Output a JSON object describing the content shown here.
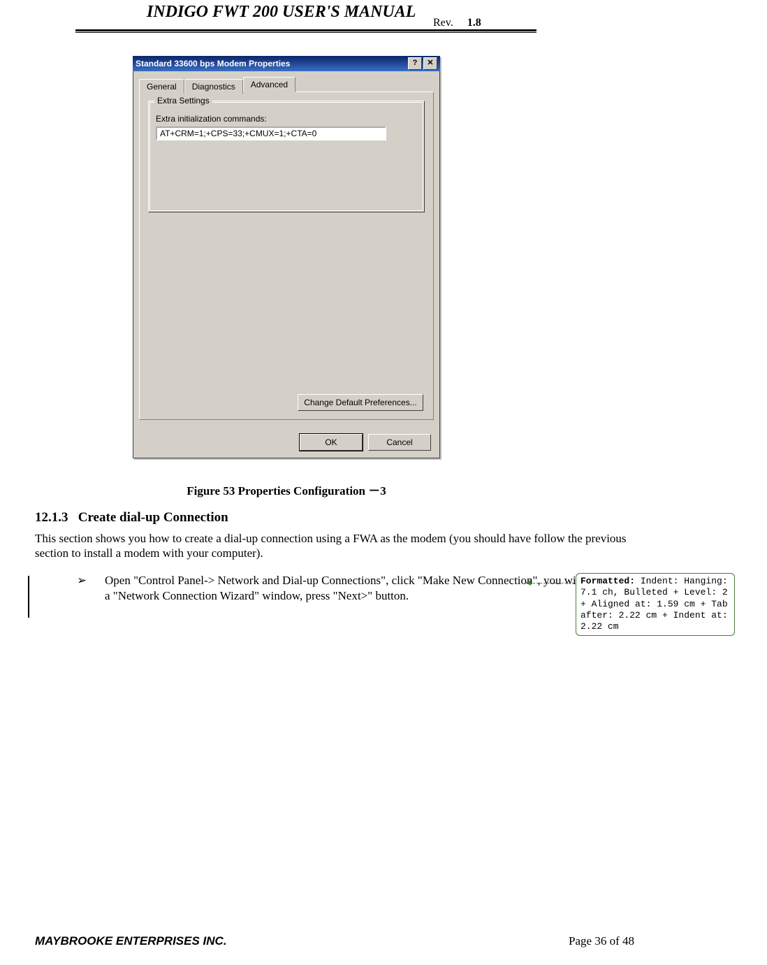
{
  "header": {
    "title": "INDIGO FWT 200 USER'S MANUAL",
    "rev_label": "Rev.",
    "rev_value": "1.8"
  },
  "dialog": {
    "title": "Standard 33600 bps Modem Properties",
    "help_btn": "?",
    "close_btn": "✕",
    "tabs": {
      "general": "General",
      "diagnostics": "Diagnostics",
      "advanced": "Advanced"
    },
    "groupbox_title": "Extra Settings",
    "field_label": "Extra initialization commands:",
    "field_value": "AT+CRM=1;+CPS=33;+CMUX=1;+CTA=0",
    "change_btn": "Change Default Preferences...",
    "ok_btn": "OK",
    "cancel_btn": "Cancel"
  },
  "figure_caption": "Figure 53 Properties Configuration －3",
  "section": {
    "heading_number": "12.1.3",
    "heading_text": "Create dial-up Connection",
    "body": "This section shows you how to create a dial-up connection using a FWA as the modem (you should have follow the previous section to install a modem with your computer)."
  },
  "bullet": {
    "mark": "➢",
    "text": "Open \"Control Panel-> Network and Dial-up Connections\", click \"Make New Connection\", you will see a \"Network Connection Wizard\" window, press \"Next>\" button."
  },
  "callout": {
    "label": "Formatted:",
    "text": " Indent: Hanging:  7.1 ch, Bulleted + Level: 2 + Aligned at:  1.59 cm + Tab after:  2.22 cm + Indent at:  2.22 cm"
  },
  "footer": {
    "company": "MAYBROOKE ENTERPRISES INC.",
    "page": "Page 36 of 48"
  }
}
